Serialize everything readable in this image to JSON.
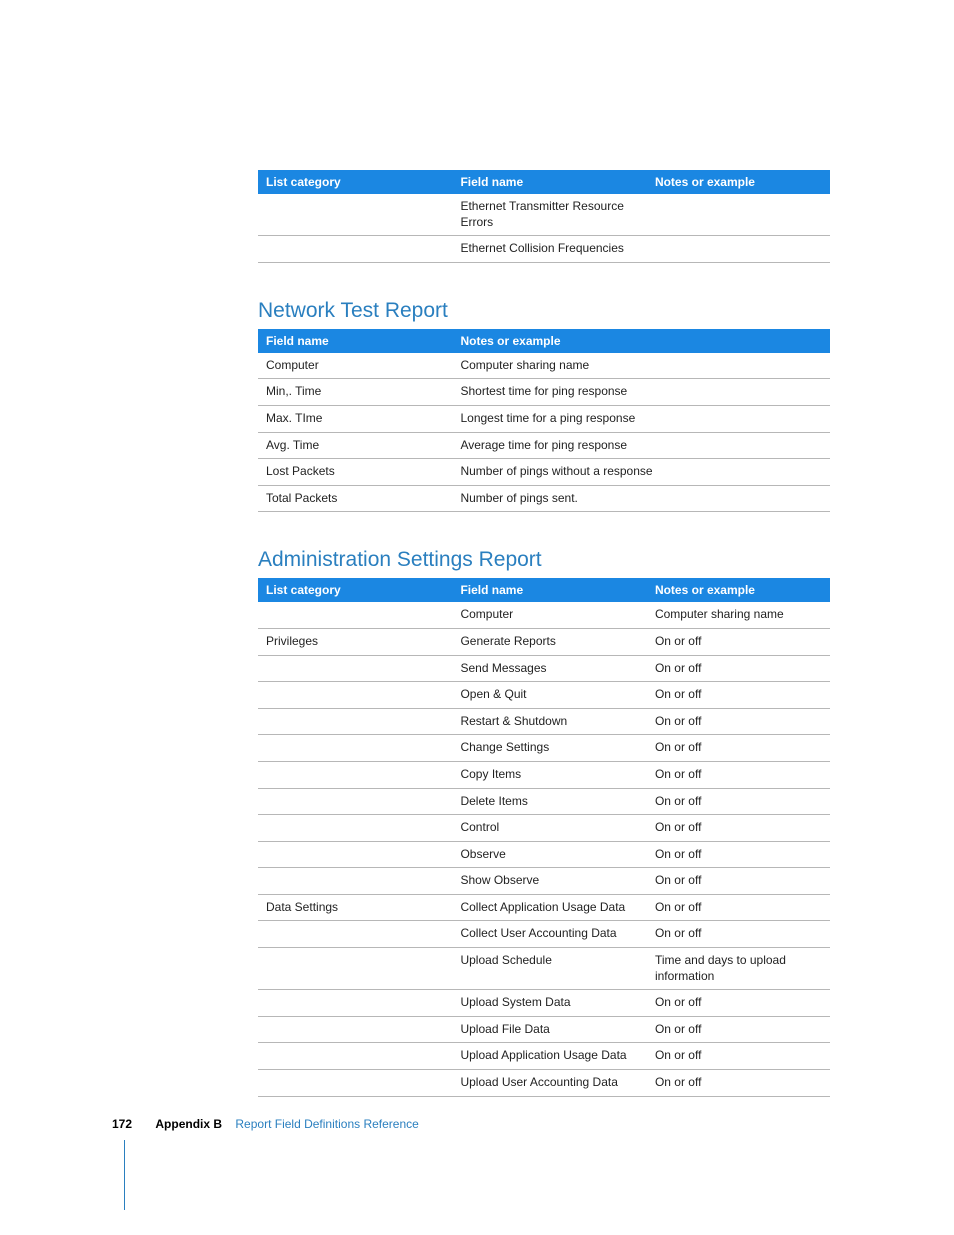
{
  "table1": {
    "headers": [
      "List category",
      "Field name",
      "Notes or example"
    ],
    "rows": [
      {
        "c1": "",
        "c2": "Ethernet Transmitter Resource Errors",
        "c3": ""
      },
      {
        "c1": "",
        "c2": "Ethernet Collision Frequencies",
        "c3": ""
      }
    ]
  },
  "section2": {
    "title": "Network Test Report"
  },
  "table2": {
    "headers": [
      "Field name",
      "Notes or example"
    ],
    "rows": [
      {
        "c1": "Computer",
        "c2": "Computer sharing name"
      },
      {
        "c1": "Min,. Time",
        "c2": "Shortest time for ping response"
      },
      {
        "c1": "Max. TIme",
        "c2": "Longest time for a ping response"
      },
      {
        "c1": "Avg. Time",
        "c2": "Average time for ping response"
      },
      {
        "c1": "Lost Packets",
        "c2": "Number of pings without a response"
      },
      {
        "c1": "Total Packets",
        "c2": "Number of pings sent."
      }
    ]
  },
  "section3": {
    "title": "Administration Settings Report"
  },
  "table3": {
    "headers": [
      "List category",
      "Field name",
      "Notes or example"
    ],
    "rows": [
      {
        "c1": "",
        "c2": "Computer",
        "c3": "Computer sharing name"
      },
      {
        "c1": "Privileges",
        "c2": "Generate Reports",
        "c3": "On or off"
      },
      {
        "c1": "",
        "c2": "Send Messages",
        "c3": "On or off"
      },
      {
        "c1": "",
        "c2": "Open & Quit",
        "c3": "On or off"
      },
      {
        "c1": "",
        "c2": "Restart & Shutdown",
        "c3": "On or off"
      },
      {
        "c1": "",
        "c2": "Change Settings",
        "c3": "On or off"
      },
      {
        "c1": "",
        "c2": "Copy Items",
        "c3": "On or off"
      },
      {
        "c1": "",
        "c2": "Delete Items",
        "c3": "On or off"
      },
      {
        "c1": "",
        "c2": "Control",
        "c3": "On or off"
      },
      {
        "c1": "",
        "c2": "Observe",
        "c3": "On or off"
      },
      {
        "c1": "",
        "c2": "Show Observe",
        "c3": "On or off"
      },
      {
        "c1": "Data Settings",
        "c2": "Collect Application Usage Data",
        "c3": "On or off"
      },
      {
        "c1": "",
        "c2": "Collect User Accounting Data",
        "c3": "On or off"
      },
      {
        "c1": "",
        "c2": "Upload Schedule",
        "c3": "Time and days to upload information"
      },
      {
        "c1": "",
        "c2": "Upload System Data",
        "c3": "On or off"
      },
      {
        "c1": "",
        "c2": "Upload File Data",
        "c3": "On or off"
      },
      {
        "c1": "",
        "c2": "Upload Application Usage Data",
        "c3": "On or off"
      },
      {
        "c1": "",
        "c2": "Upload User Accounting Data",
        "c3": "On or off"
      }
    ]
  },
  "footer": {
    "page_number": "172",
    "appendix": "Appendix B",
    "title": "Report Field Definitions Reference"
  }
}
